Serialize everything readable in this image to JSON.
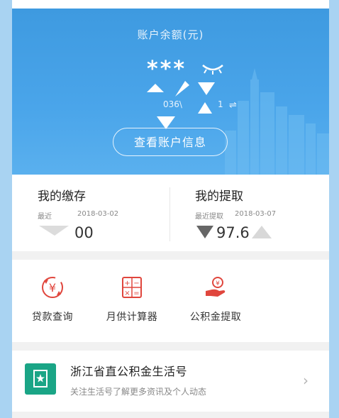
{
  "hero": {
    "title": "账户余额(元)",
    "balance_masked": "***",
    "account_fragment": "036\\",
    "account_fragment_2": "1",
    "swap_glyph": "⇌",
    "view_button_label": "查看账户信息"
  },
  "deposit": {
    "title": "我的缴存",
    "date_label": "最近",
    "date": "2018-03-02",
    "value": "00"
  },
  "withdraw": {
    "title": "我的提取",
    "date_label": "最近提取",
    "date": "2018-03-07",
    "value": "97.6"
  },
  "tools": [
    {
      "label": "贷款查询",
      "icon": "yen-coin-icon"
    },
    {
      "label": "月供计算器",
      "icon": "calculator-icon"
    },
    {
      "label": "公积金提取",
      "icon": "coin-hand-icon"
    }
  ],
  "service": {
    "title": "浙江省直公积金生活号",
    "subtitle": "关注生活号了解更多资讯及个人动态",
    "icon": "star-bookmark-icon"
  },
  "colors": {
    "hero_blue": "#4aa5ea",
    "accent_red": "#e0463d",
    "service_green": "#1aa586"
  }
}
